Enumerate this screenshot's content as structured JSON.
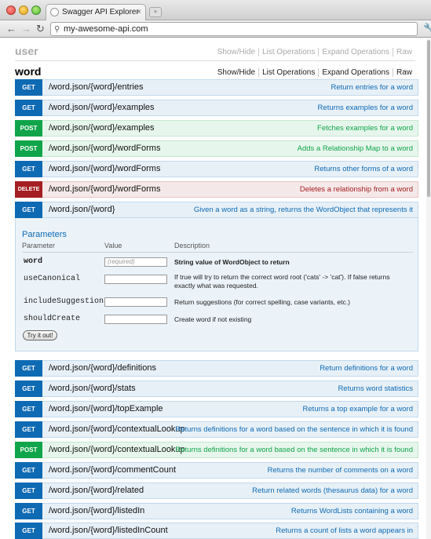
{
  "browser": {
    "tab_title": "Swagger API Explorer",
    "tab_close": "×",
    "new_tab": "+",
    "url": "my-awesome-api.com",
    "back": "←",
    "forward": "→",
    "reload": "↻",
    "search_glyph": "⚲",
    "wrench": "🔧"
  },
  "resources": {
    "user": {
      "name": "user",
      "links": [
        "Show/Hide",
        "List Operations",
        "Expand Operations",
        "Raw"
      ]
    },
    "word": {
      "name": "word",
      "links": [
        "Show/Hide",
        "List Operations",
        "Expand Operations",
        "Raw"
      ]
    }
  },
  "operations": [
    {
      "method": "GET",
      "path": "/word.json/{word}/entries",
      "desc": "Return entries for a word"
    },
    {
      "method": "GET",
      "path": "/word.json/{word}/examples",
      "desc": "Returns examples for a word"
    },
    {
      "method": "POST",
      "path": "/word.json/{word}/examples",
      "desc": "Fetches examples for a word"
    },
    {
      "method": "POST",
      "path": "/word.json/{word}/wordForms",
      "desc": "Adds a Relationship Map to a word"
    },
    {
      "method": "GET",
      "path": "/word.json/{word}/wordForms",
      "desc": "Returns other forms of a word"
    },
    {
      "method": "DELETE",
      "path": "/word.json/{word}/wordForms",
      "desc": "Deletes a relationship from a word"
    },
    {
      "method": "GET",
      "path": "/word.json/{word}",
      "desc": "Given a word as a string, returns the WordObject that represents it"
    }
  ],
  "expanded": {
    "title": "Parameters",
    "headers": {
      "parameter": "Parameter",
      "value": "Value",
      "description": "Description"
    },
    "params": [
      {
        "name": "word",
        "placeholder": "(required)",
        "desc": "String value of WordObject to return"
      },
      {
        "name": "useCanonical",
        "placeholder": "",
        "desc": "If true will try to return the correct word root ('cats' -> 'cat'). If false returns exactly what was requested."
      },
      {
        "name": "includeSuggestions",
        "placeholder": "",
        "desc": "Return suggestions (for correct spelling, case variants, etc.)"
      },
      {
        "name": "shouldCreate",
        "placeholder": "",
        "desc": "Create word if not existing"
      }
    ],
    "try_label": "Try it out!"
  },
  "operations2": [
    {
      "method": "GET",
      "path": "/word.json/{word}/definitions",
      "desc": "Return definitions for a word"
    },
    {
      "method": "GET",
      "path": "/word.json/{word}/stats",
      "desc": "Returns word statistics"
    },
    {
      "method": "GET",
      "path": "/word.json/{word}/topExample",
      "desc": "Returns a top example for a word"
    },
    {
      "method": "GET",
      "path": "/word.json/{word}/contextualLookup",
      "desc": "Returns definitions for a word based on the sentence in which it is found"
    },
    {
      "method": "POST",
      "path": "/word.json/{word}/contextualLookup",
      "desc": "Returns definitions for a word based on the sentence in which it is found"
    },
    {
      "method": "GET",
      "path": "/word.json/{word}/commentCount",
      "desc": "Returns the number of comments on a word"
    },
    {
      "method": "GET",
      "path": "/word.json/{word}/related",
      "desc": "Return related words (thesaurus data) for a word"
    },
    {
      "method": "GET",
      "path": "/word.json/{word}/listedIn",
      "desc": "Returns WordLists containing a word"
    },
    {
      "method": "GET",
      "path": "/word.json/{word}/listedInCount",
      "desc": "Returns a count of lists a word appears in"
    }
  ]
}
